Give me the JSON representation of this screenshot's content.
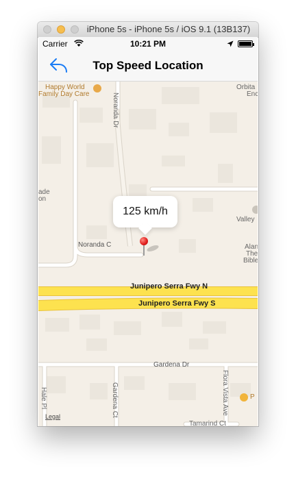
{
  "window": {
    "title": "iPhone 5s - iPhone 5s / iOS 9.1 (13B137)"
  },
  "status_bar": {
    "carrier": "Carrier",
    "time": "10:21 PM"
  },
  "nav": {
    "title": "Top Speed Location",
    "back_icon": "back-arrow-icon"
  },
  "map": {
    "labels": {
      "happy_world": "Happy World",
      "family_day_care": "Family Day Care",
      "orbita": "Orbita",
      "enc": "Enc",
      "noranda_dr": "Noranda Dr",
      "noranda_c": "Noranda C",
      "ade": "ade",
      "on": "on",
      "valley": "Valley",
      "alan": "Alan",
      "the": "The",
      "bible": "Bible",
      "junipero_n": "Junipero Serra Fwy N",
      "junipero_s": "Junipero Serra Fwy S",
      "gardena_dr": "Gardena Dr",
      "hale_pl": "Hale Pl",
      "gardena_ct": "Gardena Ct",
      "flora_vista_ave": "Flora Vista Ave",
      "tamarind_ct": "Tamarind Ct",
      "poi_p": "P",
      "legal": "Legal"
    },
    "callout": {
      "speed": "125 km/h"
    },
    "colors": {
      "land": "#f4efe7",
      "highway": "#fde24f",
      "highway_edge": "#e9c23a",
      "road": "#ffffff",
      "building": "#ebe6dd"
    }
  }
}
